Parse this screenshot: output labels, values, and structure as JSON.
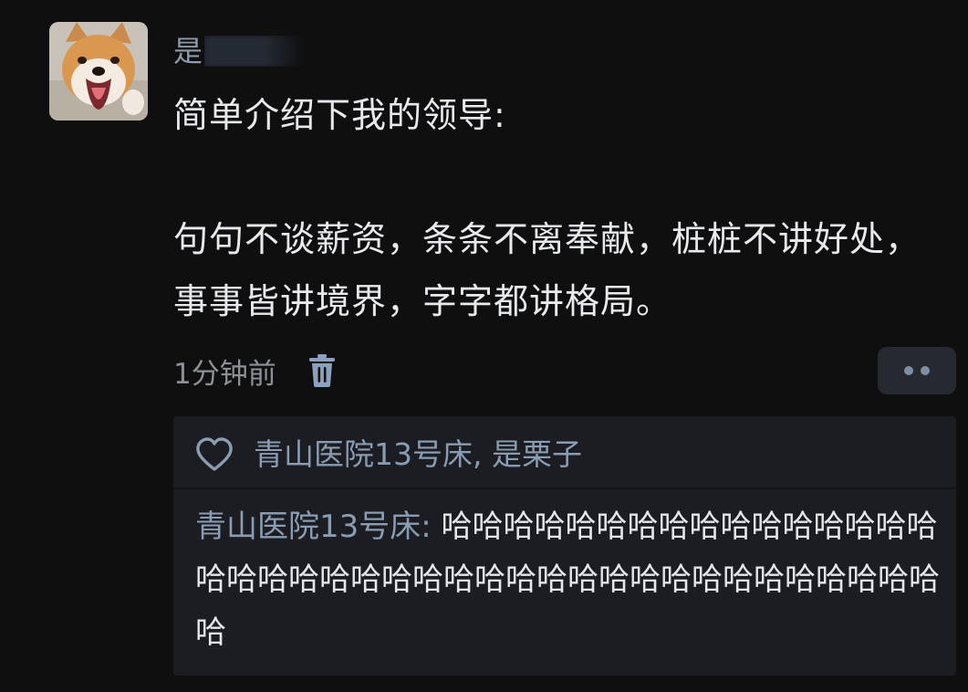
{
  "post": {
    "username_visible": "是",
    "content": "简单介绍下我的领导:\n\n句句不谈薪资，条条不离奉献，桩桩不讲好处，事事皆讲境界，字字都讲格局。",
    "time": "1分钟前"
  },
  "likes": {
    "text": "青山医院13号床, 是栗子"
  },
  "reply": {
    "author": "青山医院13号床: ",
    "text": "哈哈哈哈哈哈哈哈哈哈哈哈哈哈哈哈哈哈哈哈哈哈哈哈哈哈哈哈哈哈哈哈哈哈哈哈哈哈哈哈哈"
  },
  "colors": {
    "background": "#0f0f10",
    "card": "#1b1d22",
    "accent_blue": "#8a9cb1",
    "text": "#e7e9ec"
  },
  "icons": {
    "avatar": "shiba-dog-avatar",
    "delete": "trash-icon",
    "more": "more-dots-icon",
    "like": "heart-outline-icon"
  }
}
